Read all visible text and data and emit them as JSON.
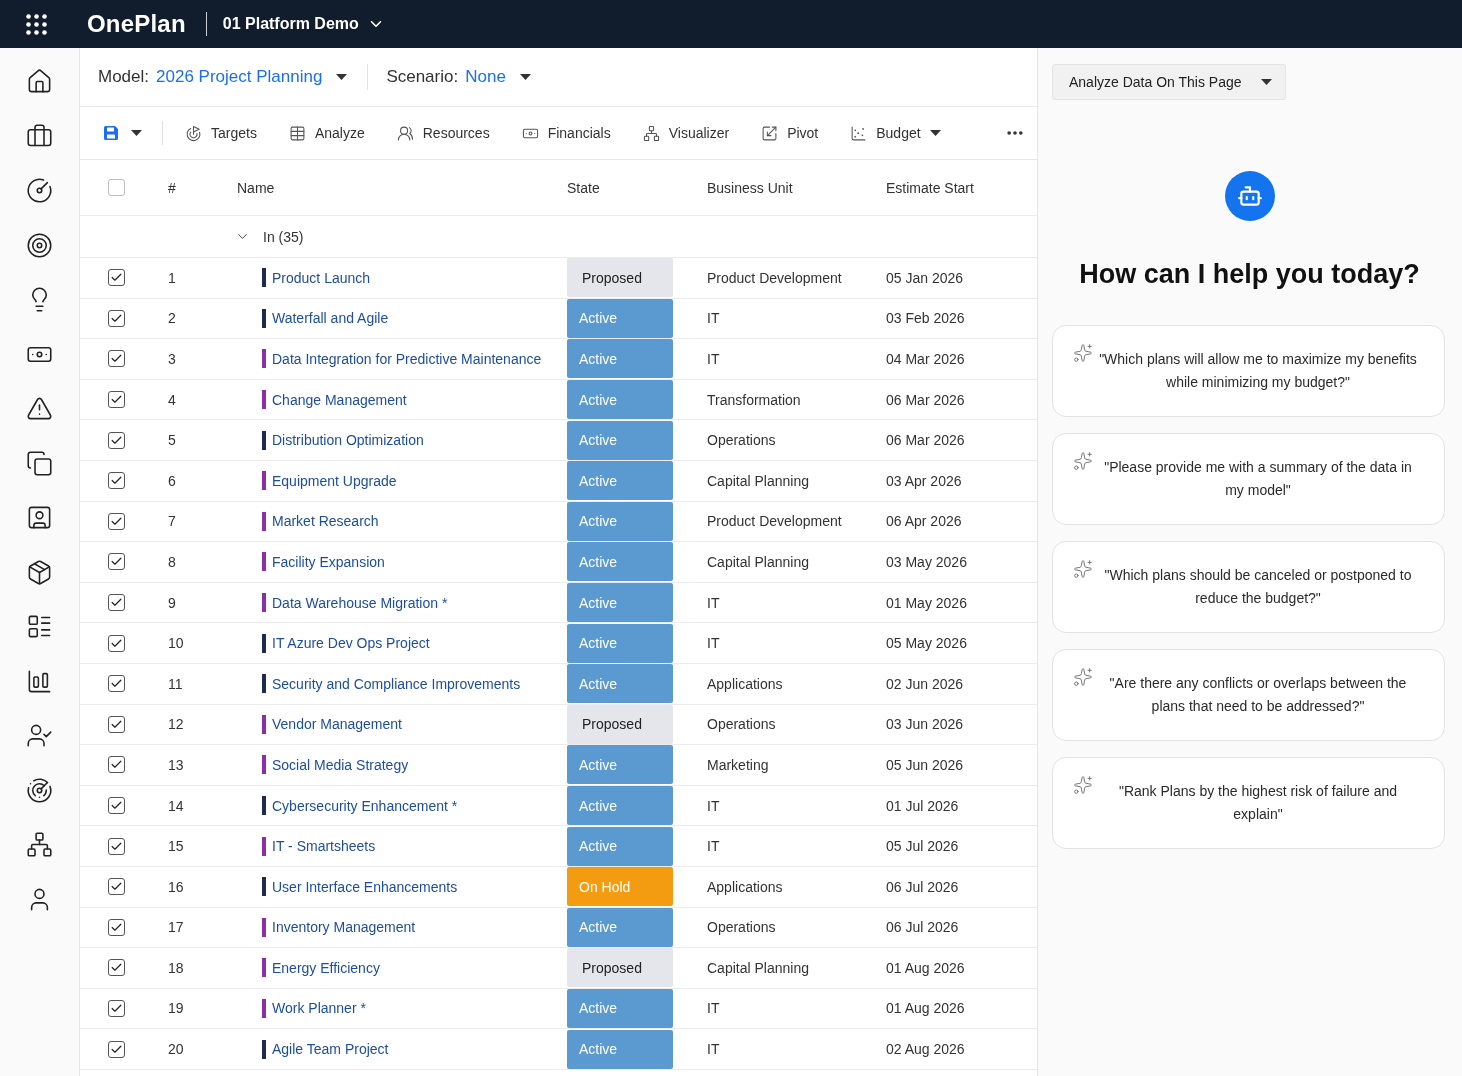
{
  "top_bar": {
    "brand": "OnePlan",
    "workspace": "01 Platform Demo"
  },
  "model_bar": {
    "model_label": "Model:",
    "model_value": "2026 Project Planning",
    "scenario_label": "Scenario:",
    "scenario_value": "None"
  },
  "toolbar": {
    "items": [
      {
        "label": "Targets",
        "kind": "button"
      },
      {
        "label": "Analyze",
        "kind": "button"
      },
      {
        "label": "Resources",
        "kind": "button"
      },
      {
        "label": "Financials",
        "kind": "button"
      },
      {
        "label": "Visualizer",
        "kind": "button"
      },
      {
        "label": "Pivot",
        "kind": "button"
      },
      {
        "label": "Budget",
        "kind": "menu"
      }
    ]
  },
  "table": {
    "select_all_checked": false,
    "columns": [
      "#",
      "Name",
      "State",
      "Business Unit",
      "Estimate Start"
    ],
    "group": {
      "label": "In (35)",
      "expanded": true
    },
    "rows": [
      {
        "checked": true,
        "number": "1",
        "name": "Product Launch",
        "color": "#1c2b4f",
        "state": {
          "text": "Proposed",
          "kind": "proposed"
        },
        "business_unit": "Product Development",
        "estimate_start": "05 Jan 2026"
      },
      {
        "checked": true,
        "number": "2",
        "name": "Waterfall and Agile",
        "color": "#1c2b4f",
        "state": {
          "text": "Active",
          "kind": "active"
        },
        "business_unit": "IT",
        "estimate_start": "03 Feb 2026"
      },
      {
        "checked": true,
        "number": "3",
        "name": "Data Integration for Predictive Maintenance",
        "color": "#8b2fa8",
        "state": {
          "text": "Active",
          "kind": "active"
        },
        "business_unit": "IT",
        "estimate_start": "04 Mar 2026"
      },
      {
        "checked": true,
        "number": "4",
        "name": "Change Management",
        "color": "#8b2fa8",
        "state": {
          "text": "Active",
          "kind": "active"
        },
        "business_unit": "Transformation",
        "estimate_start": "06 Mar 2026"
      },
      {
        "checked": true,
        "number": "5",
        "name": "Distribution Optimization",
        "color": "#1c2b4f",
        "state": {
          "text": "Active",
          "kind": "active"
        },
        "business_unit": "Operations",
        "estimate_start": "06 Mar 2026"
      },
      {
        "checked": true,
        "number": "6",
        "name": "Equipment Upgrade",
        "color": "#8b2fa8",
        "state": {
          "text": "Active",
          "kind": "active"
        },
        "business_unit": "Capital Planning",
        "estimate_start": "03 Apr 2026"
      },
      {
        "checked": true,
        "number": "7",
        "name": "Market Research",
        "color": "#8b2fa8",
        "state": {
          "text": "Active",
          "kind": "active"
        },
        "business_unit": "Product Development",
        "estimate_start": "06 Apr 2026"
      },
      {
        "checked": true,
        "number": "8",
        "name": "Facility Expansion",
        "color": "#8b2fa8",
        "state": {
          "text": "Active",
          "kind": "active"
        },
        "business_unit": "Capital Planning",
        "estimate_start": "03 May 2026"
      },
      {
        "checked": true,
        "number": "9",
        "name": "Data Warehouse Migration *",
        "color": "#8b2fa8",
        "state": {
          "text": "Active",
          "kind": "active"
        },
        "business_unit": "IT",
        "estimate_start": "01 May 2026"
      },
      {
        "checked": true,
        "number": "10",
        "name": "IT Azure Dev Ops Project",
        "color": "#1c2b4f",
        "state": {
          "text": "Active",
          "kind": "active"
        },
        "business_unit": "IT",
        "estimate_start": "05 May 2026"
      },
      {
        "checked": true,
        "number": "11",
        "name": "Security and Compliance Improvements",
        "color": "#1c2b4f",
        "state": {
          "text": "Active",
          "kind": "active"
        },
        "business_unit": "Applications",
        "estimate_start": "02 Jun 2026"
      },
      {
        "checked": true,
        "number": "12",
        "name": "Vendor Management",
        "color": "#8b2fa8",
        "state": {
          "text": "Proposed",
          "kind": "proposed"
        },
        "business_unit": "Operations",
        "estimate_start": "03 Jun 2026"
      },
      {
        "checked": true,
        "number": "13",
        "name": "Social Media Strategy",
        "color": "#8b2fa8",
        "state": {
          "text": "Active",
          "kind": "active"
        },
        "business_unit": "Marketing",
        "estimate_start": "05 Jun 2026"
      },
      {
        "checked": true,
        "number": "14",
        "name": "Cybersecurity Enhancement *",
        "color": "#1c2b4f",
        "state": {
          "text": "Active",
          "kind": "active"
        },
        "business_unit": "IT",
        "estimate_start": "01 Jul 2026"
      },
      {
        "checked": true,
        "number": "15",
        "name": "IT - Smartsheets",
        "color": "#8b2fa8",
        "state": {
          "text": "Active",
          "kind": "active"
        },
        "business_unit": "IT",
        "estimate_start": "05 Jul 2026"
      },
      {
        "checked": true,
        "number": "16",
        "name": "User Interface Enhancements",
        "color": "#1c2b4f",
        "state": {
          "text": "On Hold",
          "kind": "on_hold"
        },
        "business_unit": "Applications",
        "estimate_start": "06 Jul 2026"
      },
      {
        "checked": true,
        "number": "17",
        "name": "Inventory Management",
        "color": "#8b2fa8",
        "state": {
          "text": "Active",
          "kind": "active"
        },
        "business_unit": "Operations",
        "estimate_start": "06 Jul 2026"
      },
      {
        "checked": true,
        "number": "18",
        "name": "Energy Efficiency",
        "color": "#8b2fa8",
        "state": {
          "text": "Proposed",
          "kind": "proposed"
        },
        "business_unit": "Capital Planning",
        "estimate_start": "01 Aug 2026"
      },
      {
        "checked": true,
        "number": "19",
        "name": "Work Planner *",
        "color": "#8b2fa8",
        "state": {
          "text": "Active",
          "kind": "active"
        },
        "business_unit": "IT",
        "estimate_start": "01 Aug 2026"
      },
      {
        "checked": true,
        "number": "20",
        "name": "Agile Team Project",
        "color": "#1c2b4f",
        "state": {
          "text": "Active",
          "kind": "active"
        },
        "business_unit": "IT",
        "estimate_start": "02 Aug 2026"
      }
    ]
  },
  "assistant": {
    "mode": "Analyze Data On This Page",
    "heading": "How can I help you today?",
    "suggestions": [
      "\"Which plans will allow me to maximize my benefits while minimizing my budget?\"",
      "\"Please provide me with a summary of the data in my model\"",
      "\"Which plans should be canceled or postponed to reduce the budget?\"",
      "\"Are there any conflicts or overlaps between the plans that need to be addressed?\"",
      "\"Rank Plans by the highest risk of failure and explain\""
    ]
  }
}
